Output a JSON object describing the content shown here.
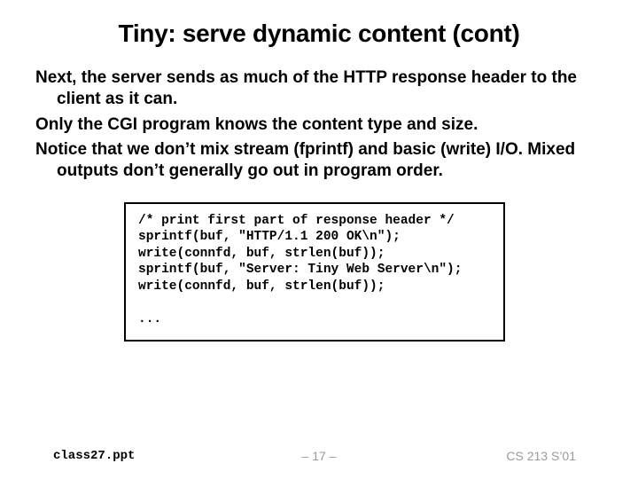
{
  "title": "Tiny: serve dynamic content (cont)",
  "paragraphs": [
    "Next, the server sends as much of the HTTP response header to the client as it can.",
    "Only the CGI program knows the content type and size.",
    "Notice that we don’t mix stream (fprintf) and basic (write) I/O. Mixed outputs don’t generally go out in program order."
  ],
  "code": "/* print first part of response header */\nsprintf(buf, \"HTTP/1.1 200 OK\\n\");\nwrite(connfd, buf, strlen(buf));\nsprintf(buf, \"Server: Tiny Web Server\\n\");\nwrite(connfd, buf, strlen(buf));\n\n...",
  "footer": {
    "left": "class27.ppt",
    "center": "– 17 –",
    "right": "CS 213 S’01"
  }
}
